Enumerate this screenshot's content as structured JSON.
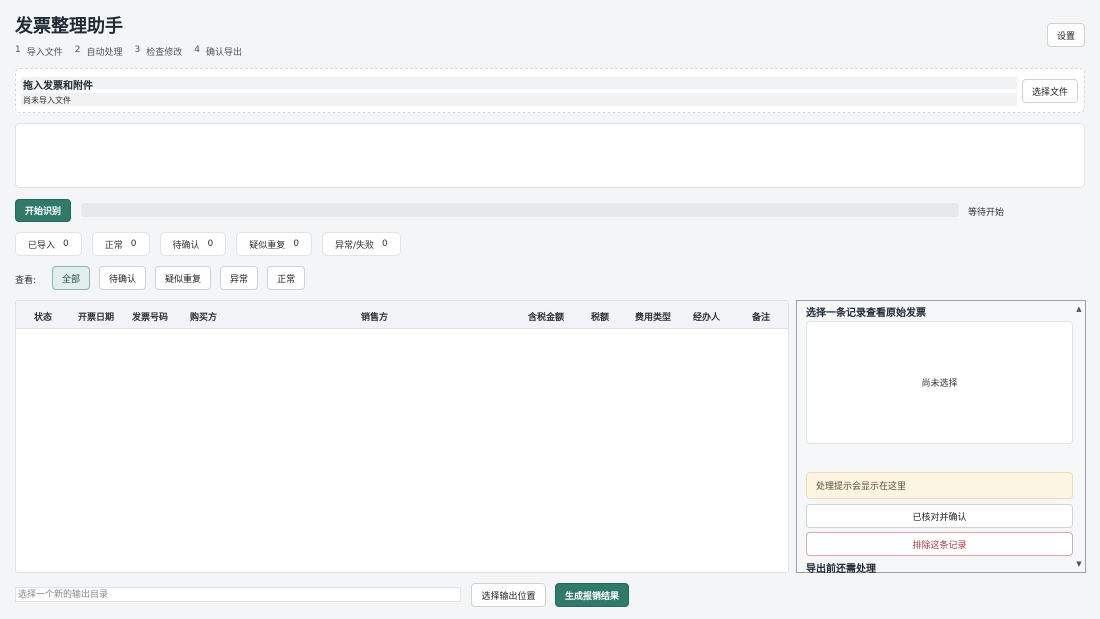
{
  "app": {
    "title": "发票整理助手",
    "settings_label": "设置"
  },
  "steps": [
    {
      "num": "1",
      "label": "导入文件"
    },
    {
      "num": "2",
      "label": "自动处理"
    },
    {
      "num": "3",
      "label": "检查修改"
    },
    {
      "num": "4",
      "label": "确认导出"
    }
  ],
  "dropzone": {
    "title": "拖入发票和附件",
    "status": "尚未导入文件",
    "choose_label": "选择文件"
  },
  "progress": {
    "start_label": "开始识别",
    "status": "等待开始",
    "value": 0
  },
  "stats": [
    {
      "label": "已导入",
      "value": "0"
    },
    {
      "label": "正常",
      "value": "0"
    },
    {
      "label": "待确认",
      "value": "0"
    },
    {
      "label": "疑似重复",
      "value": "0"
    },
    {
      "label": "异常/失败",
      "value": "0"
    }
  ],
  "filters": {
    "label": "查看:",
    "items": [
      "全部",
      "待确认",
      "疑似重复",
      "异常",
      "正常"
    ],
    "active": "全部"
  },
  "table": {
    "columns": [
      "状态",
      "开票日期",
      "发票号码",
      "购买方",
      "销售方",
      "含税金额",
      "税额",
      "费用类型",
      "经办人",
      "备注"
    ],
    "rows": []
  },
  "side": {
    "title": "选择一条记录查看原始发票",
    "preview_text": "尚未选择",
    "hint": "处理提示会显示在这里",
    "confirm_label": "已核对并确认",
    "exclude_label": "排除这条记录",
    "subtitle": "导出前还需处理"
  },
  "output": {
    "placeholder": "选择一个新的输出目录",
    "choose_label": "选择输出位置",
    "generate_label": "生成报销结果"
  }
}
